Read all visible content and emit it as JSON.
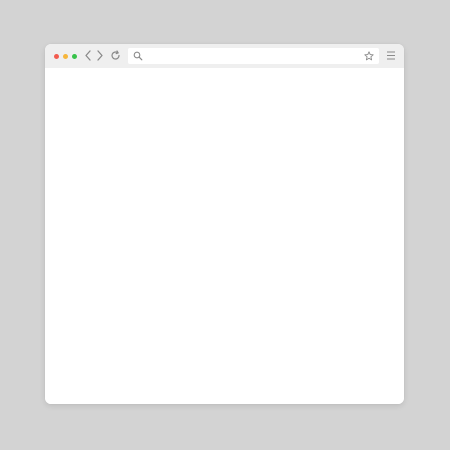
{
  "colors": {
    "background": "#d3d3d3",
    "toolbar": "#efefef",
    "close_dot": "#f25b4f",
    "minimize_dot": "#f6b63b",
    "maximize_dot": "#37c24a",
    "icon": "#8a8a8a"
  },
  "toolbar": {
    "icons": [
      "back-arrow-icon",
      "forward-arrow-icon",
      "reload-icon",
      "search-icon",
      "star-icon",
      "hamburger-menu-icon"
    ]
  },
  "address_bar": {
    "value": "",
    "placeholder": ""
  }
}
